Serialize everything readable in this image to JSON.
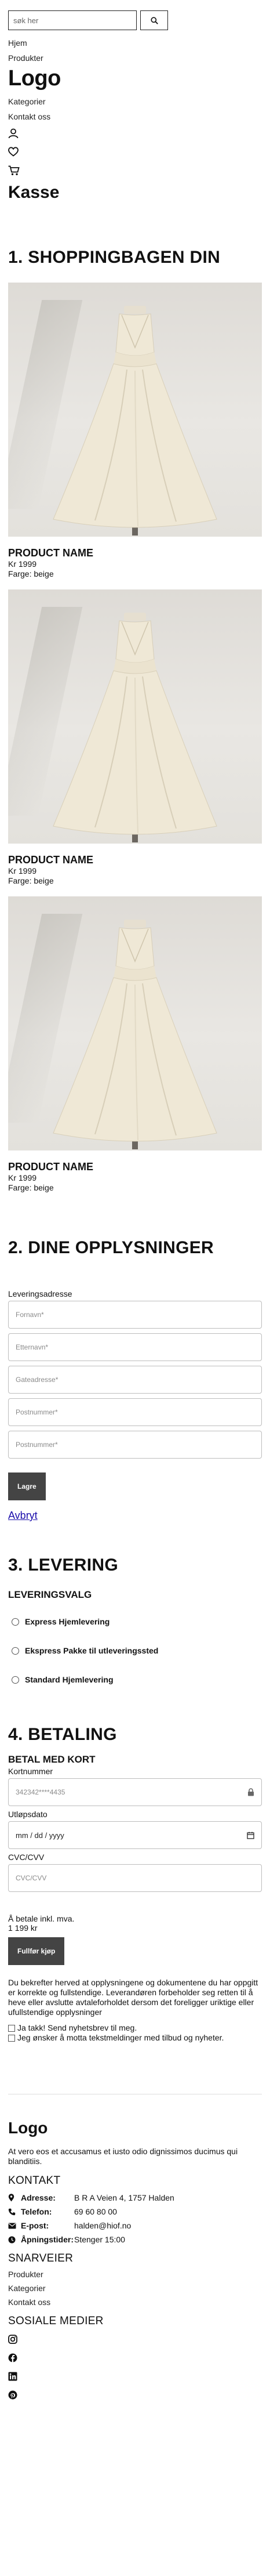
{
  "header": {
    "search_placeholder": "søk her",
    "nav": [
      "Hjem",
      "Produkter"
    ],
    "logo": "Logo",
    "nav2": [
      "Kategorier",
      "Kontakt oss"
    ],
    "icons": [
      "user-icon",
      "heart-icon",
      "cart-icon"
    ]
  },
  "page_title": "Kasse",
  "cart": {
    "title": "1. SHOPPINGBAGEN DIN",
    "products": [
      {
        "name": "PRODUCT NAME",
        "price": "Kr 1999",
        "color": "Farge: beige"
      },
      {
        "name": "PRODUCT NAME",
        "price": "Kr 1999",
        "color": "Farge: beige"
      },
      {
        "name": "PRODUCT NAME",
        "price": "Kr 1999",
        "color": "Farge: beige"
      }
    ]
  },
  "info": {
    "title": "2. DINE OPPLYSNINGER",
    "label": "Leveringsadresse",
    "placeholders": [
      "Fornavn*",
      "Etternavn*",
      "Gateadresse*",
      "Postnummer*",
      "Postnummer*"
    ],
    "save": "Lagre",
    "cancel": "Avbryt"
  },
  "delivery": {
    "title": "3. LEVERING",
    "subtitle": "LEVERINGSVALG",
    "options": [
      "Express Hjemlevering",
      "Ekspress Pakke til utleveringssted",
      "Standard Hjemlevering"
    ]
  },
  "payment": {
    "title": "4. BETALING",
    "subtitle": "BETAL MED KORT",
    "card_label": "Kortnummer",
    "card_placeholder": "342342****4435",
    "expiry_label": "Utløpsdato",
    "expiry_value": "mm / dd / yyyy",
    "cvc_label": "CVC/CVV",
    "cvc_placeholder": "CVC/CVV",
    "total_label": "Å betale inkl. mva.",
    "total_amount": "1 199 kr",
    "checkout": "Fullfør kjøp",
    "terms": "Du bekrefter herved at opplysningene og dokumentene du har oppgitt er korrekte og fullstendige. Leverandøren forbeholder seg retten til å heve eller avslutte avtaleforholdet dersom det foreligger uriktige eller ufullstendige opplysninger",
    "check1": "Ja takk! Send nyhetsbrev til meg.",
    "check2": "Jeg ønsker å motta tekstmeldinger med tilbud og nyheter."
  },
  "footer": {
    "logo": "Logo",
    "about": "At vero eos et accusamus et iusto odio dignissimos ducimus qui blanditiis.",
    "contact_title": "KONTAKT",
    "contact": [
      {
        "icon": "location-icon",
        "key": "Adresse:",
        "value": "B R A Veien 4, 1757 Halden"
      },
      {
        "icon": "phone-icon",
        "key": "Telefon:",
        "value": "69 60 80 00"
      },
      {
        "icon": "mail-icon",
        "key": "E-post:",
        "value": "halden@hiof.no"
      },
      {
        "icon": "clock-icon",
        "key": "Åpningstider:",
        "value": "Stenger 15:00"
      }
    ],
    "shortcuts_title": "SNARVEIER",
    "shortcuts": [
      "Produkter",
      "Kategorier",
      "Kontakt oss"
    ],
    "social_title": "SOSIALE MEDIER",
    "social": [
      "instagram-icon",
      "facebook-icon",
      "linkedin-icon",
      "pinterest-icon"
    ]
  }
}
